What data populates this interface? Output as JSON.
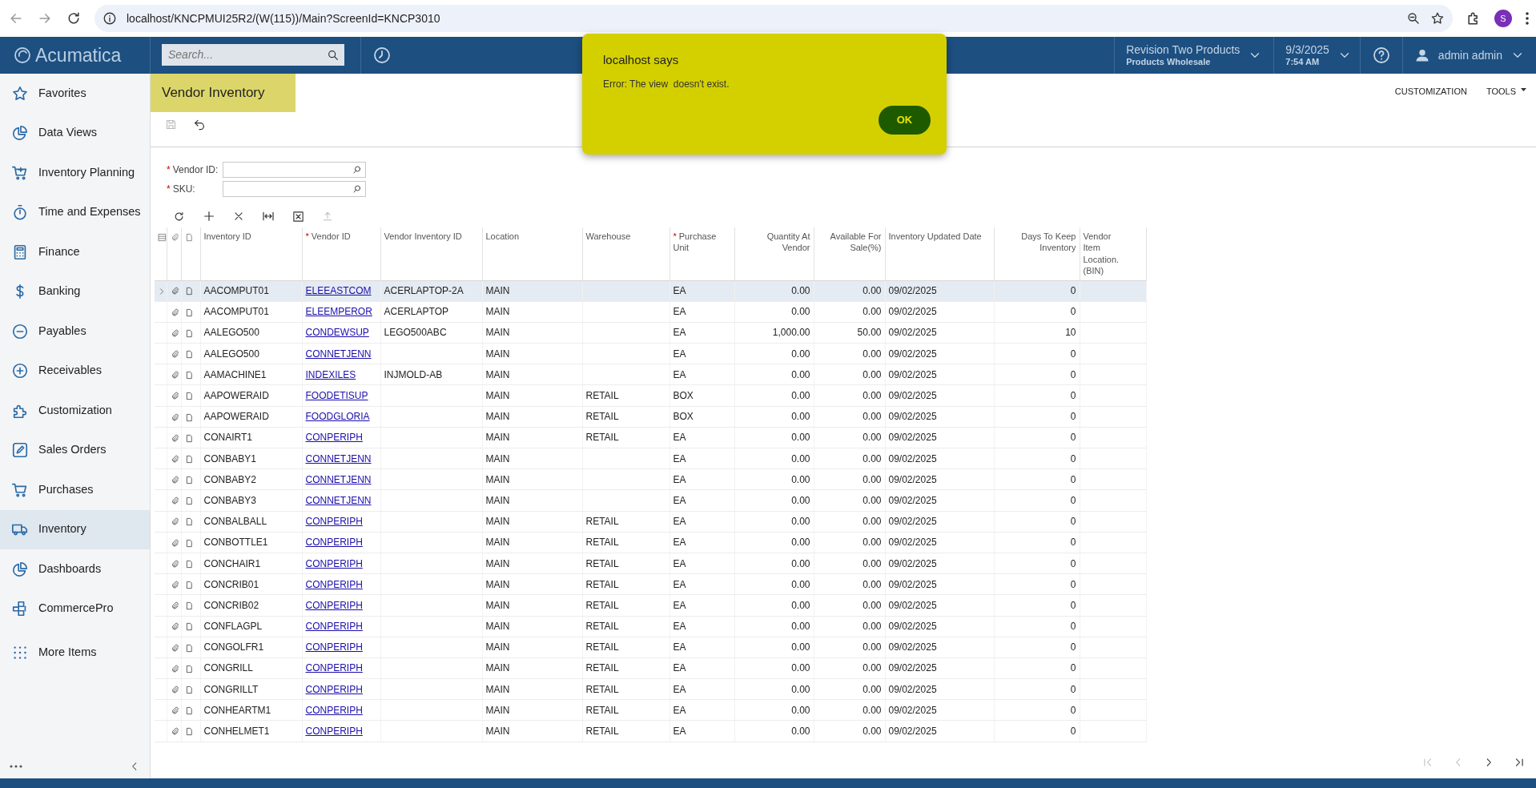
{
  "browser": {
    "url": "localhost/KNCPMUI25R2/(W(115))/Main?ScreenId=KNCP3010",
    "avatar": "S"
  },
  "app": {
    "logo": "Acumatica",
    "search": {
      "placeholder": "Search..."
    },
    "company": {
      "name": "Revision Two Products",
      "branch": "Products Wholesale"
    },
    "date": {
      "date": "9/3/2025",
      "time": "7:54 AM"
    },
    "user": "admin admin"
  },
  "sidebar": {
    "items": [
      {
        "label": "Favorites",
        "selected": false
      },
      {
        "label": "Data Views",
        "selected": false
      },
      {
        "label": "Inventory Planning",
        "selected": false
      },
      {
        "label": "Time and Expenses",
        "selected": false
      },
      {
        "label": "Finance",
        "selected": false
      },
      {
        "label": "Banking",
        "selected": false
      },
      {
        "label": "Payables",
        "selected": false
      },
      {
        "label": "Receivables",
        "selected": false
      },
      {
        "label": "Customization",
        "selected": false
      },
      {
        "label": "Sales Orders",
        "selected": false
      },
      {
        "label": "Purchases",
        "selected": false
      },
      {
        "label": "Inventory",
        "selected": true
      },
      {
        "label": "Dashboards",
        "selected": false
      },
      {
        "label": "CommercePro",
        "selected": false
      },
      {
        "label": "More Items",
        "selected": false
      }
    ]
  },
  "page": {
    "title": "Vendor Inventory",
    "actions": [
      {
        "label": "CUSTOMIZATION",
        "caret": false
      },
      {
        "label": "TOOLS",
        "caret": true
      }
    ]
  },
  "filters": [
    {
      "label": "Vendor ID:",
      "required_mark": "*"
    },
    {
      "label": "SKU:",
      "required_mark": "*"
    }
  ],
  "grid": {
    "columns": [
      {
        "label": "Inventory ID",
        "kind": "text"
      },
      {
        "label": "Vendor ID",
        "required_mark": "*",
        "kind": "link"
      },
      {
        "label": "Vendor Inventory ID",
        "kind": "text"
      },
      {
        "label": "Location",
        "kind": "text"
      },
      {
        "label": "Warehouse",
        "kind": "text"
      },
      {
        "label": "Purchase Unit",
        "required_mark": "*",
        "kind": "text"
      },
      {
        "label": "Quantity At Vendor",
        "kind": "number"
      },
      {
        "label": "Available For Sale(%)",
        "kind": "number"
      },
      {
        "label": "Inventory Updated Date",
        "kind": "text"
      },
      {
        "label": "Days To Keep Inventory",
        "kind": "number"
      },
      {
        "label": "Vendor Item Location. (BIN)",
        "kind": "narrow"
      }
    ],
    "rows": [
      {
        "selected": true,
        "cells": [
          "AACOMPUT01",
          "ELEEASTCOM",
          "ACERLAPTOP-2A",
          "MAIN",
          null,
          "EA",
          "0.00",
          "0.00",
          "09/02/2025",
          "0",
          null
        ]
      },
      {
        "selected": false,
        "cells": [
          "AACOMPUT01",
          "ELEEMPEROR",
          "ACERLAPTOP",
          "MAIN",
          null,
          "EA",
          "0.00",
          "0.00",
          "09/02/2025",
          "0",
          null
        ]
      },
      {
        "selected": false,
        "cells": [
          "AALEGO500",
          "CONDEWSUP",
          "LEGO500ABC",
          "MAIN",
          null,
          "EA",
          "1,000.00",
          "50.00",
          "09/02/2025",
          "10",
          null
        ]
      },
      {
        "selected": false,
        "cells": [
          "AALEGO500",
          "CONNETJENN",
          null,
          "MAIN",
          null,
          "EA",
          "0.00",
          "0.00",
          "09/02/2025",
          "0",
          null
        ]
      },
      {
        "selected": false,
        "cells": [
          "AAMACHINE1",
          "INDEXILES",
          "INJMOLD-AB",
          "MAIN",
          null,
          "EA",
          "0.00",
          "0.00",
          "09/02/2025",
          "0",
          null
        ]
      },
      {
        "selected": false,
        "cells": [
          "AAPOWERAID",
          "FOODETISUP",
          null,
          "MAIN",
          "RETAIL",
          "BOX",
          "0.00",
          "0.00",
          "09/02/2025",
          "0",
          null
        ]
      },
      {
        "selected": false,
        "cells": [
          "AAPOWERAID",
          "FOODGLORIA",
          null,
          "MAIN",
          "RETAIL",
          "BOX",
          "0.00",
          "0.00",
          "09/02/2025",
          "0",
          null
        ]
      },
      {
        "selected": false,
        "cells": [
          "CONAIRT1",
          "CONPERIPH",
          null,
          "MAIN",
          "RETAIL",
          "EA",
          "0.00",
          "0.00",
          "09/02/2025",
          "0",
          null
        ]
      },
      {
        "selected": false,
        "cells": [
          "CONBABY1",
          "CONNETJENN",
          null,
          "MAIN",
          null,
          "EA",
          "0.00",
          "0.00",
          "09/02/2025",
          "0",
          null
        ]
      },
      {
        "selected": false,
        "cells": [
          "CONBABY2",
          "CONNETJENN",
          null,
          "MAIN",
          null,
          "EA",
          "0.00",
          "0.00",
          "09/02/2025",
          "0",
          null
        ]
      },
      {
        "selected": false,
        "cells": [
          "CONBABY3",
          "CONNETJENN",
          null,
          "MAIN",
          null,
          "EA",
          "0.00",
          "0.00",
          "09/02/2025",
          "0",
          null
        ]
      },
      {
        "selected": false,
        "cells": [
          "CONBALBALL",
          "CONPERIPH",
          null,
          "MAIN",
          "RETAIL",
          "EA",
          "0.00",
          "0.00",
          "09/02/2025",
          "0",
          null
        ]
      },
      {
        "selected": false,
        "cells": [
          "CONBOTTLE1",
          "CONPERIPH",
          null,
          "MAIN",
          "RETAIL",
          "EA",
          "0.00",
          "0.00",
          "09/02/2025",
          "0",
          null
        ]
      },
      {
        "selected": false,
        "cells": [
          "CONCHAIR1",
          "CONPERIPH",
          null,
          "MAIN",
          "RETAIL",
          "EA",
          "0.00",
          "0.00",
          "09/02/2025",
          "0",
          null
        ]
      },
      {
        "selected": false,
        "cells": [
          "CONCRIB01",
          "CONPERIPH",
          null,
          "MAIN",
          "RETAIL",
          "EA",
          "0.00",
          "0.00",
          "09/02/2025",
          "0",
          null
        ]
      },
      {
        "selected": false,
        "cells": [
          "CONCRIB02",
          "CONPERIPH",
          null,
          "MAIN",
          "RETAIL",
          "EA",
          "0.00",
          "0.00",
          "09/02/2025",
          "0",
          null
        ]
      },
      {
        "selected": false,
        "cells": [
          "CONFLAGPL",
          "CONPERIPH",
          null,
          "MAIN",
          "RETAIL",
          "EA",
          "0.00",
          "0.00",
          "09/02/2025",
          "0",
          null
        ]
      },
      {
        "selected": false,
        "cells": [
          "CONGOLFR1",
          "CONPERIPH",
          null,
          "MAIN",
          "RETAIL",
          "EA",
          "0.00",
          "0.00",
          "09/02/2025",
          "0",
          null
        ]
      },
      {
        "selected": false,
        "cells": [
          "CONGRILL",
          "CONPERIPH",
          null,
          "MAIN",
          "RETAIL",
          "EA",
          "0.00",
          "0.00",
          "09/02/2025",
          "0",
          null
        ]
      },
      {
        "selected": false,
        "cells": [
          "CONGRILLT",
          "CONPERIPH",
          null,
          "MAIN",
          "RETAIL",
          "EA",
          "0.00",
          "0.00",
          "09/02/2025",
          "0",
          null
        ]
      },
      {
        "selected": false,
        "cells": [
          "CONHEARTM1",
          "CONPERIPH",
          null,
          "MAIN",
          "RETAIL",
          "EA",
          "0.00",
          "0.00",
          "09/02/2025",
          "0",
          null
        ]
      },
      {
        "selected": false,
        "cells": [
          "CONHELMET1",
          "CONPERIPH",
          null,
          "MAIN",
          "RETAIL",
          "EA",
          "0.00",
          "0.00",
          "09/02/2025",
          "0",
          null
        ]
      }
    ]
  },
  "dialog": {
    "title": "localhost says",
    "message": "Error: The view  doesn't exist.",
    "button": "OK"
  }
}
